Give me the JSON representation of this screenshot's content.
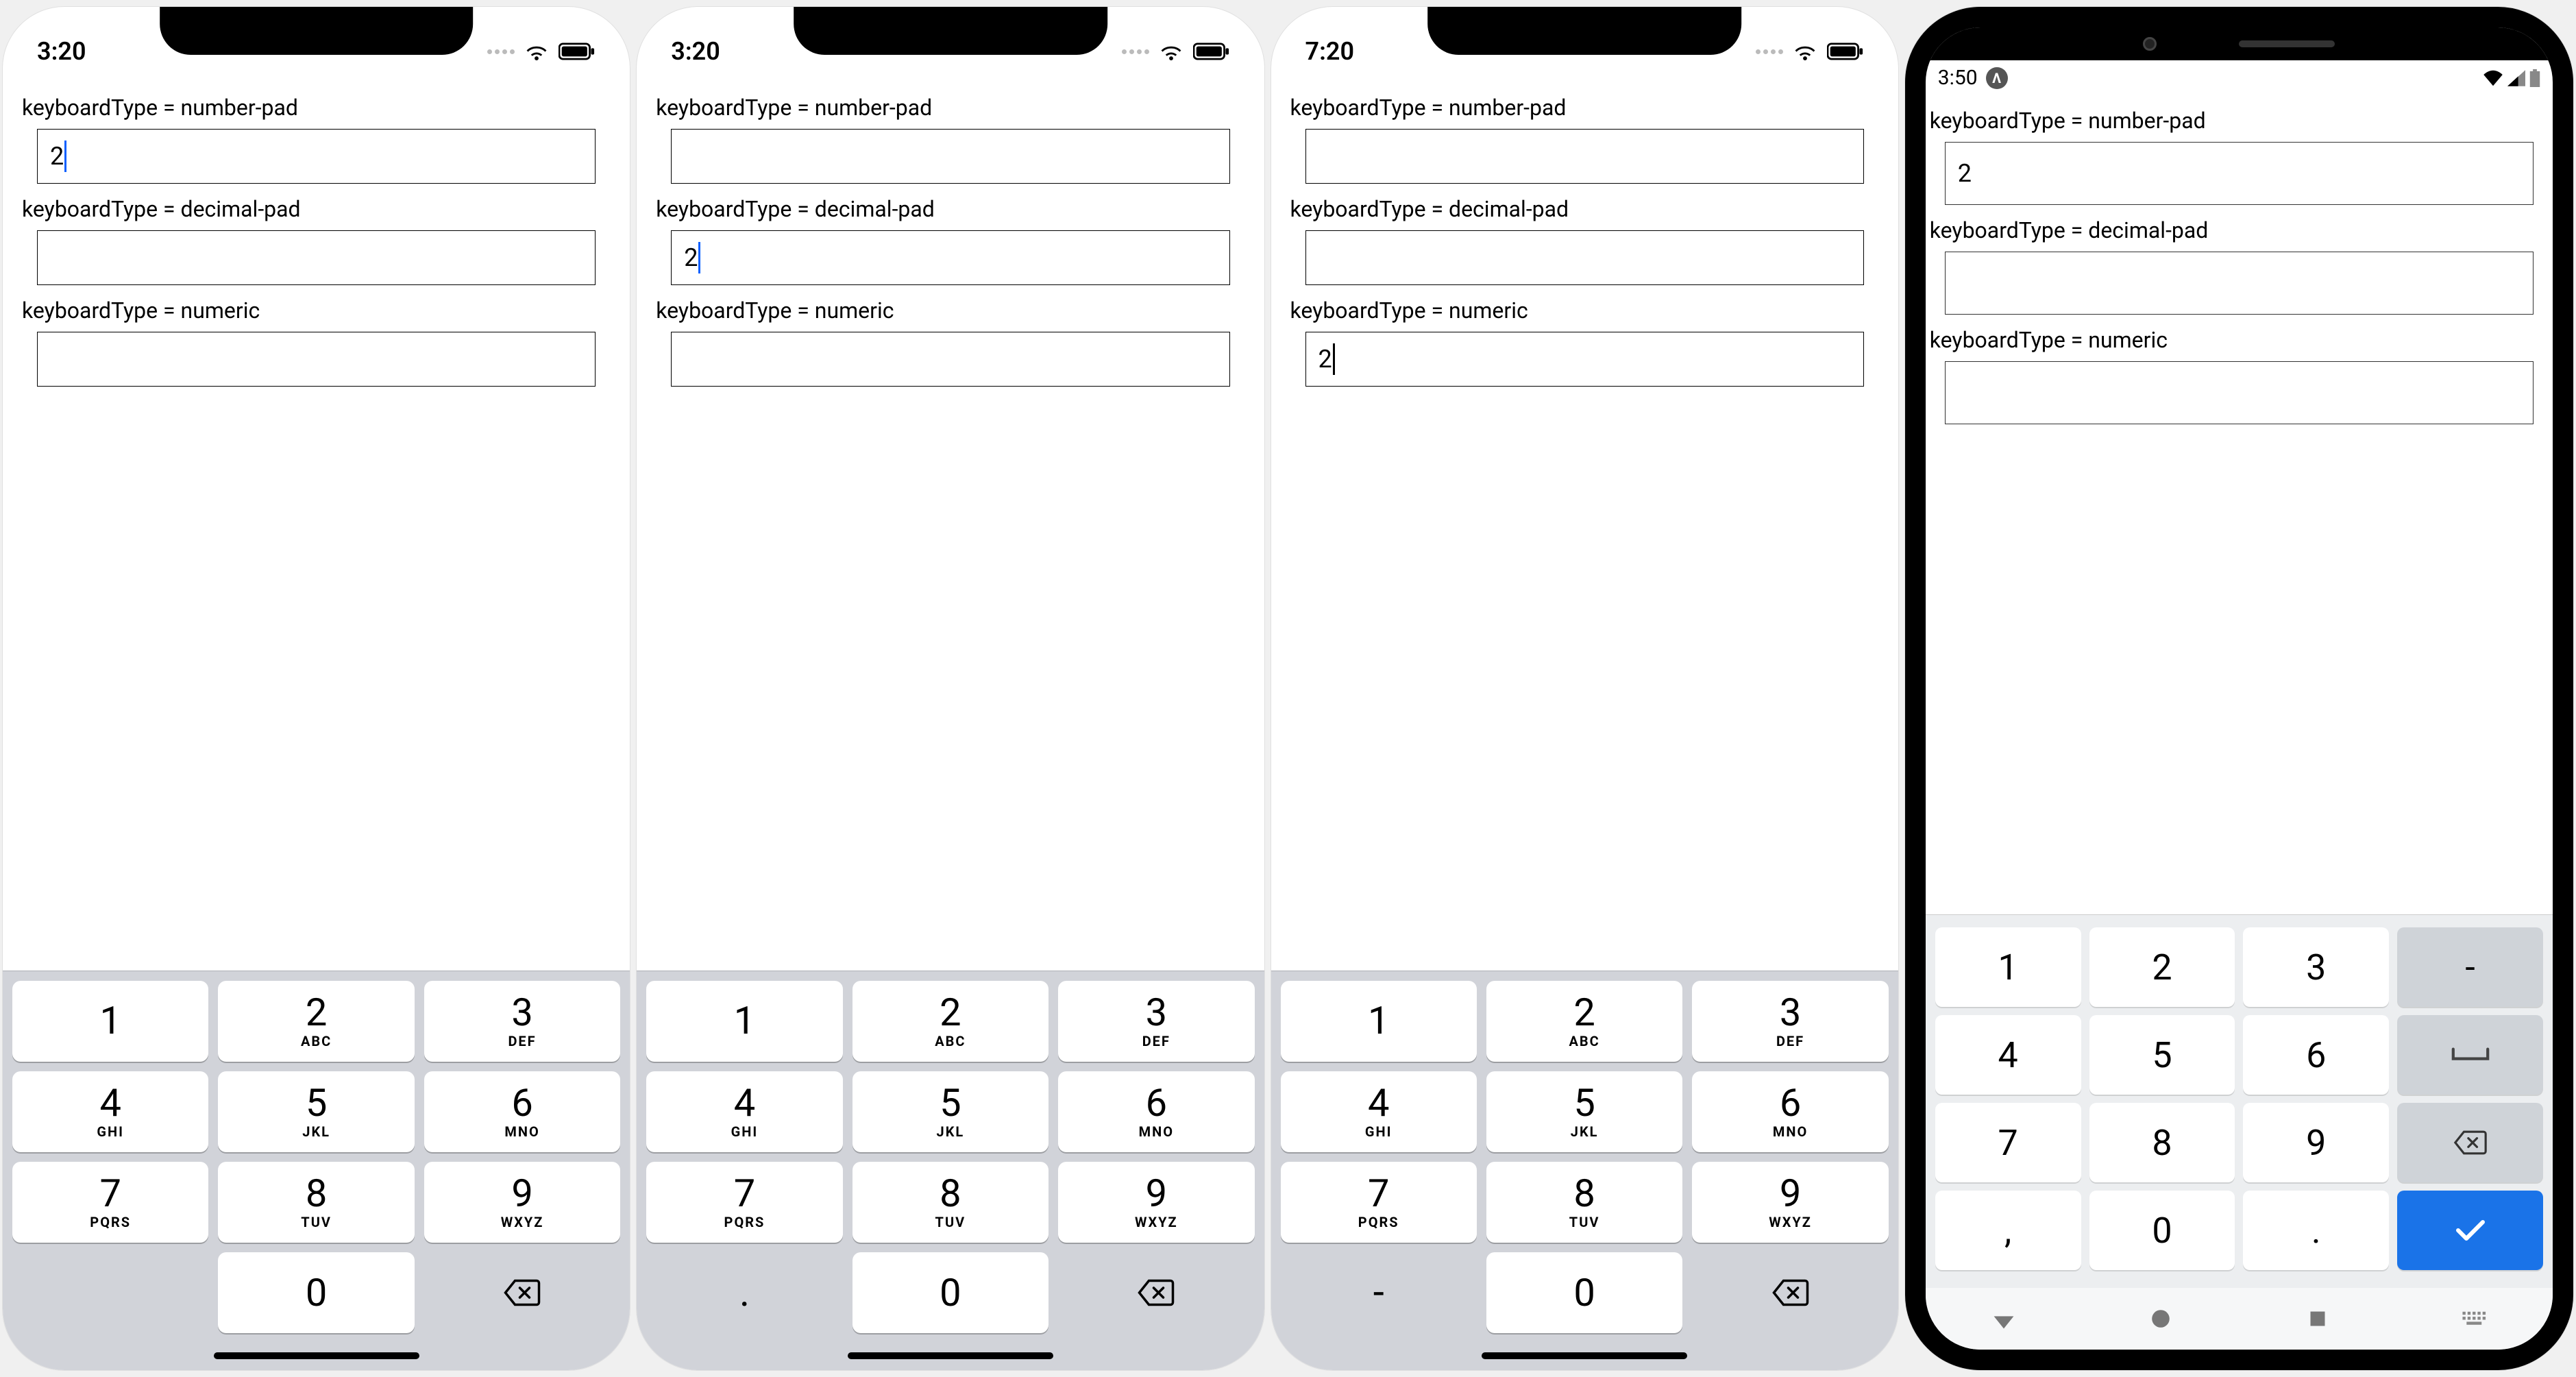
{
  "frames": [
    {
      "platform": "ios",
      "status_time": "3:20",
      "fields": [
        {
          "label": "keyboardType = number-pad",
          "value": "2",
          "focused": true
        },
        {
          "label": "keyboardType = decimal-pad",
          "value": "",
          "focused": false
        },
        {
          "label": "keyboardType = numeric",
          "value": "",
          "focused": false
        }
      ],
      "keyboard_variant": "number-pad",
      "keyboard": {
        "rows": [
          [
            {
              "d": "1",
              "l": ""
            },
            {
              "d": "2",
              "l": "ABC"
            },
            {
              "d": "3",
              "l": "DEF"
            }
          ],
          [
            {
              "d": "4",
              "l": "GHI"
            },
            {
              "d": "5",
              "l": "JKL"
            },
            {
              "d": "6",
              "l": "MNO"
            }
          ],
          [
            {
              "d": "7",
              "l": "PQRS"
            },
            {
              "d": "8",
              "l": "TUV"
            },
            {
              "d": "9",
              "l": "WXYZ"
            }
          ],
          [
            {
              "blank": true
            },
            {
              "d": "0",
              "l": ""
            },
            {
              "util": "backspace"
            }
          ]
        ]
      }
    },
    {
      "platform": "ios",
      "status_time": "3:20",
      "fields": [
        {
          "label": "keyboardType = number-pad",
          "value": "",
          "focused": false
        },
        {
          "label": "keyboardType = decimal-pad",
          "value": "2",
          "focused": true
        },
        {
          "label": "keyboardType = numeric",
          "value": "",
          "focused": false
        }
      ],
      "keyboard_variant": "decimal-pad",
      "keyboard": {
        "rows": [
          [
            {
              "d": "1",
              "l": ""
            },
            {
              "d": "2",
              "l": "ABC"
            },
            {
              "d": "3",
              "l": "DEF"
            }
          ],
          [
            {
              "d": "4",
              "l": "GHI"
            },
            {
              "d": "5",
              "l": "JKL"
            },
            {
              "d": "6",
              "l": "MNO"
            }
          ],
          [
            {
              "d": "7",
              "l": "PQRS"
            },
            {
              "d": "8",
              "l": "TUV"
            },
            {
              "d": "9",
              "l": "WXYZ"
            }
          ],
          [
            {
              "util": "period",
              "d": "."
            },
            {
              "d": "0",
              "l": ""
            },
            {
              "util": "backspace"
            }
          ]
        ]
      }
    },
    {
      "platform": "ios",
      "status_time": "7:20",
      "fields": [
        {
          "label": "keyboardType = number-pad",
          "value": "",
          "focused": false
        },
        {
          "label": "keyboardType = decimal-pad",
          "value": "",
          "focused": false
        },
        {
          "label": "keyboardType = numeric",
          "value": "2",
          "focused": true
        }
      ],
      "keyboard_variant": "numeric",
      "keyboard": {
        "rows": [
          [
            {
              "d": "1",
              "l": ""
            },
            {
              "d": "2",
              "l": "ABC"
            },
            {
              "d": "3",
              "l": "DEF"
            }
          ],
          [
            {
              "d": "4",
              "l": "GHI"
            },
            {
              "d": "5",
              "l": "JKL"
            },
            {
              "d": "6",
              "l": "MNO"
            }
          ],
          [
            {
              "d": "7",
              "l": "PQRS"
            },
            {
              "d": "8",
              "l": "TUV"
            },
            {
              "d": "9",
              "l": "WXYZ"
            }
          ],
          [
            {
              "util": "hyphen",
              "d": "-"
            },
            {
              "d": "0",
              "l": ""
            },
            {
              "util": "backspace"
            }
          ]
        ]
      }
    },
    {
      "platform": "android",
      "status_time": "3:50",
      "fields": [
        {
          "label": "keyboardType = number-pad",
          "value": "2",
          "focused": true
        },
        {
          "label": "keyboardType = decimal-pad",
          "value": "",
          "focused": false
        },
        {
          "label": "keyboardType = numeric",
          "value": "",
          "focused": false
        }
      ],
      "keyboard_variant": "android-numeric",
      "keyboard": {
        "rows": [
          [
            {
              "d": "1"
            },
            {
              "d": "2"
            },
            {
              "d": "3"
            },
            {
              "util": "minus",
              "gray": true,
              "d": "-"
            }
          ],
          [
            {
              "d": "4"
            },
            {
              "d": "5"
            },
            {
              "d": "6"
            },
            {
              "util": "space",
              "gray": true
            }
          ],
          [
            {
              "d": "7"
            },
            {
              "d": "8"
            },
            {
              "d": "9"
            },
            {
              "util": "backspace",
              "gray": true
            }
          ],
          [
            {
              "d": ","
            },
            {
              "d": "0"
            },
            {
              "d": "."
            },
            {
              "util": "done",
              "blue": true
            }
          ]
        ]
      }
    }
  ]
}
